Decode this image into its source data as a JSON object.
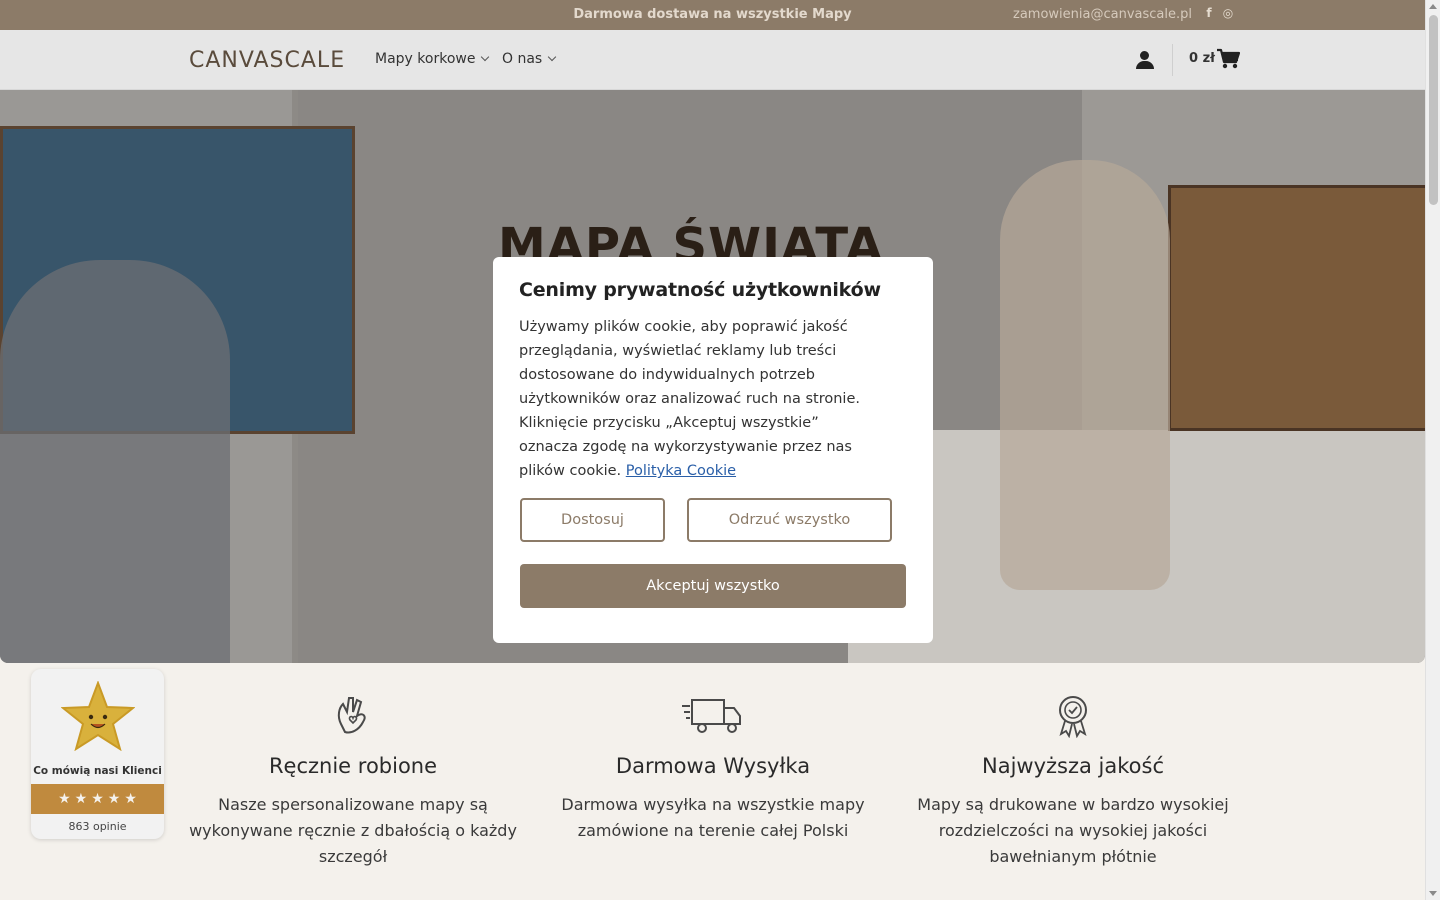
{
  "topbar": {
    "promo": "Darmowa dostawa na wszystkie Mapy",
    "email": "zamowienia@canvascale.pl",
    "social": [
      {
        "icon": "facebook-icon",
        "glyph": "f"
      },
      {
        "icon": "instagram-icon",
        "glyph": "◎"
      }
    ]
  },
  "header": {
    "logo": "CANVASCALE",
    "nav": [
      {
        "label": "Mapy korkowe"
      },
      {
        "label": "O nas"
      }
    ],
    "cart_total": "0 zł"
  },
  "hero": {
    "title": "MAPA ŚWIATA"
  },
  "cookie_modal": {
    "title": "Cenimy prywatność użytkowników",
    "body": "Używamy plików cookie, aby poprawić jakość przeglądania, wyświetlać reklamy lub treści dostosowane do indywidualnych potrzeb użytkowników oraz analizować ruch na stronie. Kliknięcie przycisku „Akceptuj wszystkie” oznacza zgodę na wykorzystywanie przez nas plików cookie.",
    "policy_link": "Polityka Cookie",
    "customize_label": "Dostosuj",
    "reject_label": "Odrzuć wszystko",
    "accept_label": "Akceptuj wszystko"
  },
  "features": [
    {
      "icon": "hand-heart-icon",
      "title": "Ręcznie robione",
      "text": "Nasze spersonalizowane mapy są wykonywane ręcznie z dbałością o każdy szczegół"
    },
    {
      "icon": "delivery-truck-icon",
      "title": "Darmowa Wysyłka",
      "text": "Darmowa wysyłka na wszystkie mapy zamówione na terenie całej Polski"
    },
    {
      "icon": "quality-badge-icon",
      "title": "Najwyższa jakość",
      "text": "Mapy są drukowane w bardzo wysokiej rozdzielczości na wysokiej jakości bawełnianym płótnie"
    }
  ],
  "review_widget": {
    "label": "Co mówią nasi Klienci",
    "rating": 5,
    "count": "863 opinie"
  },
  "colors": {
    "brand": "#8c7b68",
    "topbar_text": "#e3d9cd",
    "link": "#2a5fa8",
    "review_bar": "#c08a3e"
  }
}
